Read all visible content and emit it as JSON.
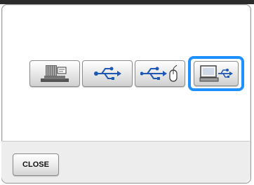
{
  "footer": {
    "close_label": "CLOSE"
  },
  "buttons": [
    {
      "icon": "embroidery-machine-icon"
    },
    {
      "icon": "usb-icon"
    },
    {
      "icon": "usb-mouse-icon"
    },
    {
      "icon": "computer-usb-icon",
      "selected": true
    }
  ],
  "colors": {
    "selected_outline": "#1e90ff",
    "icon_blue": "#1f57b4"
  }
}
